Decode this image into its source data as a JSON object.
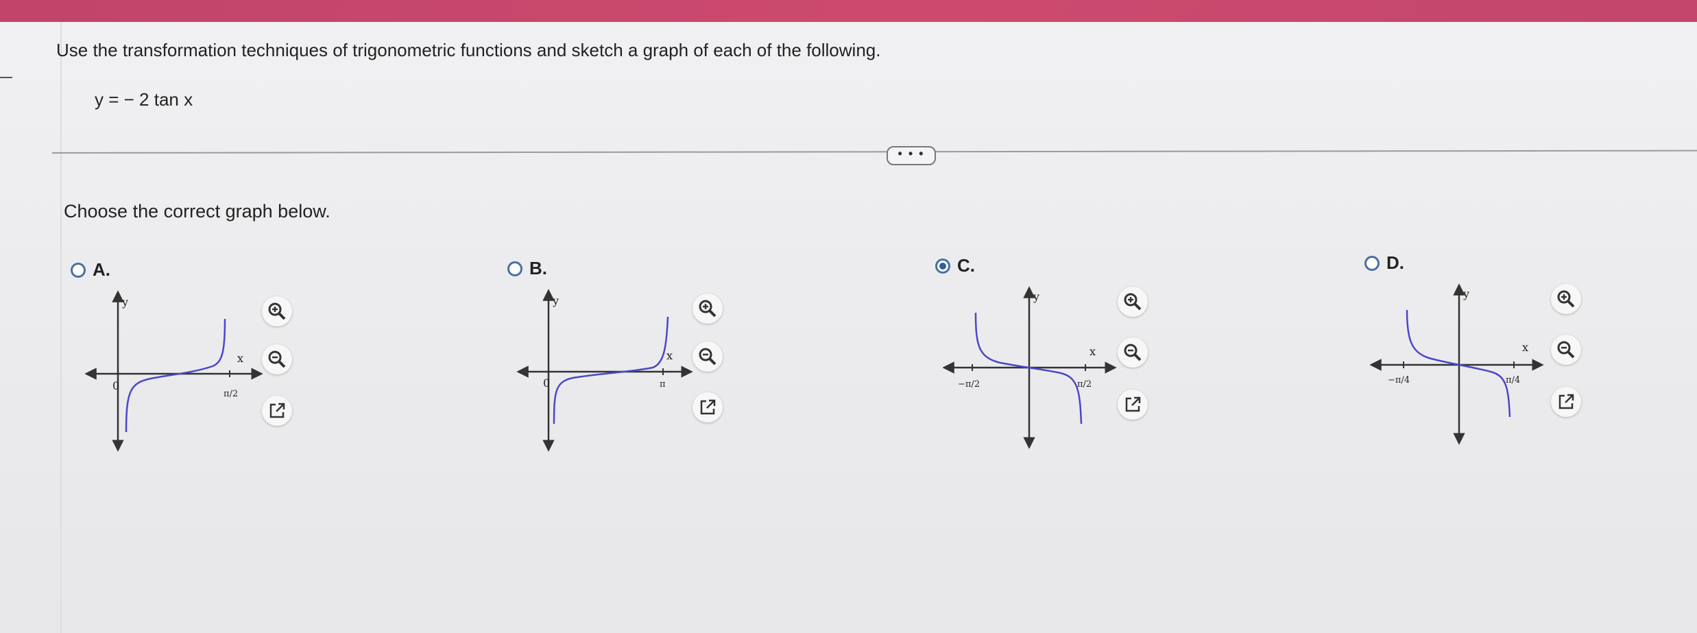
{
  "question": {
    "instruction": "Use the transformation techniques of trigonometric functions and sketch a graph of each of the following.",
    "equation": "y = − 2 tan x"
  },
  "more_button": {
    "label": "• • •"
  },
  "prompt": "Choose the correct graph below.",
  "options": [
    {
      "label": "A.",
      "selected": false,
      "axis_y": "y",
      "axis_x": "x",
      "origin": "0",
      "tick_right": "π/2"
    },
    {
      "label": "B.",
      "selected": false,
      "axis_y": "y",
      "axis_x": "x",
      "origin": "0",
      "tick_right": "π"
    },
    {
      "label": "C.",
      "selected": true,
      "axis_y": "y",
      "axis_x": "x",
      "tick_left": "−π/2",
      "tick_right": "π/2"
    },
    {
      "label": "D.",
      "selected": false,
      "axis_y": "y",
      "axis_x": "x",
      "tick_left": "−π/4",
      "tick_right": "π/4"
    }
  ],
  "tools": {
    "zoom_in": "zoom-in-icon",
    "zoom_out": "zoom-out-icon",
    "open": "open-new-window-icon"
  },
  "colors": {
    "accent_band": "#c8466c",
    "curve": "#4b46c9",
    "radio": "#2f5f9e"
  }
}
